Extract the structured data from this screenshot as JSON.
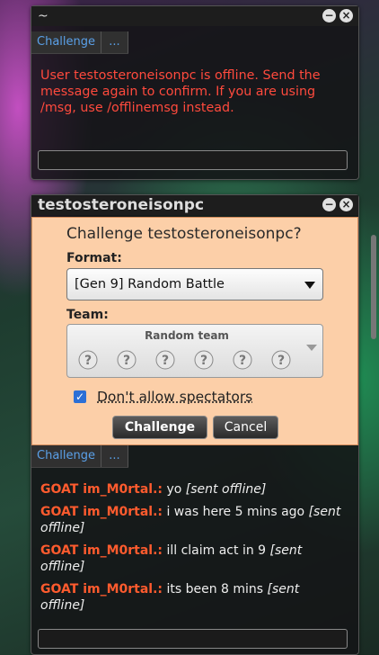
{
  "window1": {
    "title": "~",
    "tabs": [
      "Challenge",
      "..."
    ],
    "offline_message": "User testosteroneisonpc is offline. Send the message again to confirm. If you are using /msg, use /offlinemsg instead."
  },
  "window2": {
    "title": "testosteroneisonpc",
    "challenge": {
      "heading": "Challenge testosteroneisonpc?",
      "format_label": "Format:",
      "format_value": "[Gen 9] Random Battle",
      "team_label": "Team:",
      "team_value": "Random team",
      "spectators_label": "Don't allow spectators",
      "spectators_checked": true,
      "challenge_button": "Challenge",
      "cancel_button": "Cancel"
    },
    "tabs": [
      "Challenge",
      "..."
    ],
    "messages": [
      {
        "user": "GOAT im_M0rtal.:",
        "text": "yo",
        "note": "[sent offline]"
      },
      {
        "user": "GOAT im_M0rtal.:",
        "text": "i was here 5 mins ago",
        "note": "[sent offline]"
      },
      {
        "user": "GOAT im_M0rtal.:",
        "text": "ill claim act in 9",
        "note": "[sent offline]"
      },
      {
        "user": "GOAT im_M0rtal.:",
        "text": "its been 8 mins",
        "note": "[sent offline]"
      }
    ]
  },
  "icons": {
    "minimize": "minimize-icon",
    "close": "close-icon",
    "pokeball": "pokeball-placeholder-icon"
  },
  "colors": {
    "accent_tab": "#5aa0e8",
    "error": "#ff4a3d",
    "username": "#ff5b2e",
    "challenge_bg": "#fccfa8"
  }
}
